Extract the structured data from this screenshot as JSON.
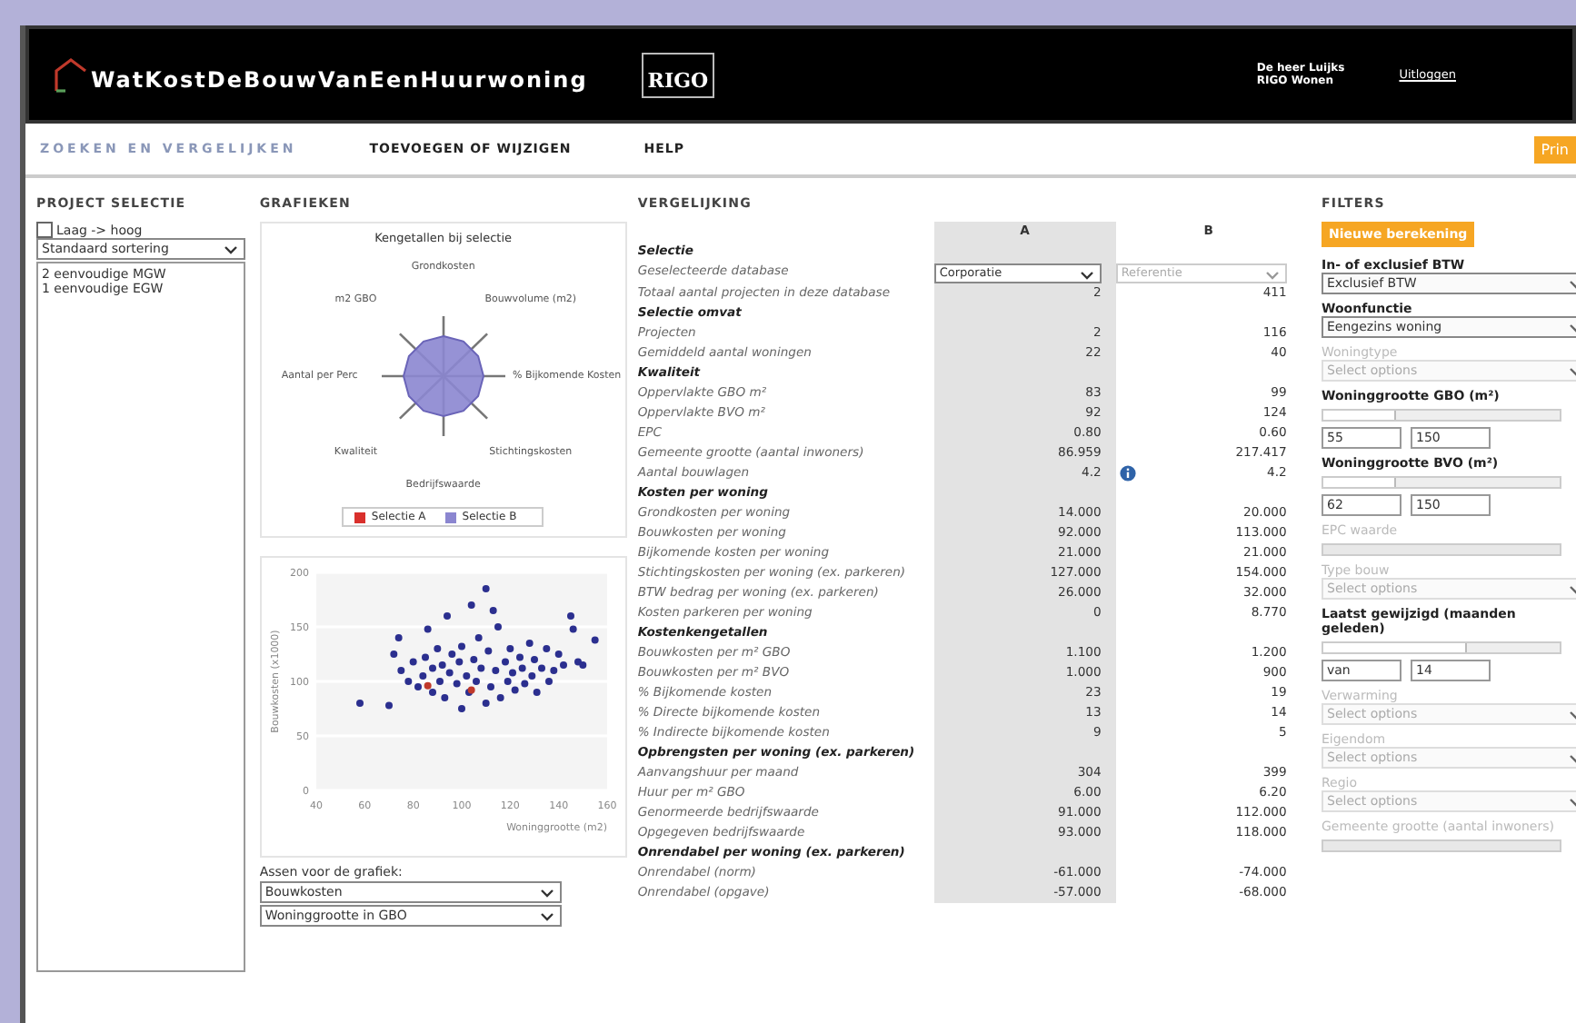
{
  "header": {
    "logo": "WatKostDeBouwVanEenHuurwoning",
    "partner_logo": "RIGO",
    "user": "De heer Luijks",
    "organisation": "RIGO Wonen",
    "logout": "Uitloggen"
  },
  "nav": {
    "tabs": [
      {
        "label": "ZOEKEN EN VERGELIJKEN",
        "selected": true
      },
      {
        "label": "TOEVOEGEN OF WIJZIGEN",
        "selected": false
      },
      {
        "label": "HELP",
        "selected": false
      }
    ],
    "action": "Prin"
  },
  "project_selectie": {
    "title": "PROJECT SELECTIE",
    "sort_checkbox": {
      "label": "Laag -> hoog",
      "checked": false
    },
    "sort_select": "Standaard sortering",
    "items": [
      "2 eenvoudige MGW",
      "1 eenvoudige EGW"
    ]
  },
  "grafieken": {
    "title": "GRAFIEKEN",
    "radar": {
      "title": "Kengetallen bij selectie",
      "axes": [
        "Grondkosten",
        "m2 GBO",
        "Bouwvolume (m2)",
        "Aantal per Perc",
        "% Bijkomende Kosten",
        "Kwaliteit",
        "Stichtingskosten",
        "Bedrijfswaarde"
      ],
      "legend": [
        {
          "label": "Selectie A",
          "color": "#d9302c"
        },
        {
          "label": "Selectie B",
          "color": "#8b86d0"
        }
      ]
    },
    "scatter": {
      "chart_data": {
        "type": "scatter",
        "xlabel": "Woninggrootte (m2)",
        "ylabel": "Bouwkosten (x1000)",
        "xlim": [
          40,
          160
        ],
        "ylim": [
          0,
          200
        ],
        "xticks": [
          40,
          60,
          80,
          100,
          120,
          140,
          160
        ],
        "yticks": [
          0,
          50,
          100,
          150,
          200
        ],
        "grid": true,
        "series": [
          {
            "color": "#2b2f8f",
            "x": [
              58,
              70,
              74,
              72,
              75,
              78,
              80,
              82,
              84,
              85,
              86,
              88,
              88,
              90,
              91,
              92,
              93,
              94,
              95,
              96,
              98,
              99,
              100,
              100,
              102,
              103,
              104,
              105,
              106,
              107,
              108,
              110,
              110,
              111,
              112,
              113,
              114,
              115,
              116,
              118,
              119,
              120,
              121,
              122,
              124,
              125,
              126,
              128,
              129,
              130,
              131,
              133,
              135,
              136,
              138,
              140,
              142,
              145,
              146,
              148,
              150,
              155
            ],
            "values": [
              80,
              78,
              140,
              125,
              110,
              100,
              118,
              95,
              105,
              122,
              148,
              90,
              112,
              130,
              100,
              115,
              85,
              160,
              108,
              125,
              98,
              118,
              75,
              132,
              105,
              90,
              170,
              120,
              100,
              140,
              112,
              80,
              185,
              128,
              95,
              165,
              110,
              150,
              85,
              118,
              100,
              130,
              108,
              92,
              122,
              112,
              98,
              135,
              105,
              120,
              90,
              112,
              130,
              100,
              110,
              125,
              115,
              160,
              148,
              118,
              115,
              138
            ]
          },
          {
            "color": "#c0392b",
            "x": [
              86,
              104
            ],
            "values": [
              96,
              92
            ]
          }
        ]
      }
    },
    "axes_label": "Assen voor de grafiek:",
    "axes_selects": [
      "Bouwkosten",
      "Woninggrootte in GBO"
    ]
  },
  "vergelijking": {
    "title": "VERGELIJKING",
    "columns": [
      "A",
      "B"
    ],
    "rows": [
      {
        "kind": "section",
        "label": "Selectie"
      },
      {
        "kind": "select",
        "label": "Geselecteerde database",
        "a": "Corporatie",
        "b": "Referentie"
      },
      {
        "kind": "value",
        "label": "Totaal aantal projecten in deze database",
        "a": "2",
        "b": "411"
      },
      {
        "kind": "section",
        "label": "Selectie omvat"
      },
      {
        "kind": "value",
        "label": "Projecten",
        "a": "2",
        "b": "116"
      },
      {
        "kind": "value",
        "label": "Gemiddeld aantal woningen",
        "a": "22",
        "b": "40"
      },
      {
        "kind": "section",
        "label": "Kwaliteit"
      },
      {
        "kind": "value",
        "label": "Oppervlakte GBO m²",
        "a": "83",
        "b": "99"
      },
      {
        "kind": "value",
        "label": "Oppervlakte BVO m²",
        "a": "92",
        "b": "124"
      },
      {
        "kind": "value",
        "label": "EPC",
        "a": "0.80",
        "b": "0.60"
      },
      {
        "kind": "value",
        "label": "Gemeente grootte (aantal inwoners)",
        "a": "86.959",
        "b": "217.417"
      },
      {
        "kind": "value",
        "label": "Aantal bouwlagen",
        "a": "4.2",
        "b": "4.2",
        "info": true
      },
      {
        "kind": "section",
        "label": "Kosten per woning"
      },
      {
        "kind": "value",
        "label": "Grondkosten per woning",
        "a": "14.000",
        "b": "20.000"
      },
      {
        "kind": "value",
        "label": "Bouwkosten per woning",
        "a": "92.000",
        "b": "113.000"
      },
      {
        "kind": "value",
        "label": "Bijkomende kosten per woning",
        "a": "21.000",
        "b": "21.000"
      },
      {
        "kind": "value",
        "label": "Stichtingskosten per woning (ex. parkeren)",
        "a": "127.000",
        "b": "154.000"
      },
      {
        "kind": "value",
        "label": "BTW bedrag per woning (ex. parkeren)",
        "a": "26.000",
        "b": "32.000"
      },
      {
        "kind": "value",
        "label": "Kosten parkeren per woning",
        "a": "0",
        "b": "8.770"
      },
      {
        "kind": "section",
        "label": "Kostenkengetallen"
      },
      {
        "kind": "value",
        "label": "Bouwkosten per m² GBO",
        "a": "1.100",
        "b": "1.200"
      },
      {
        "kind": "value",
        "label": "Bouwkosten per m² BVO",
        "a": "1.000",
        "b": "900"
      },
      {
        "kind": "value",
        "label": "% Bijkomende kosten",
        "a": "23",
        "b": "19"
      },
      {
        "kind": "value",
        "label": "% Directe bijkomende kosten",
        "a": "13",
        "b": "14"
      },
      {
        "kind": "value",
        "label": "% Indirecte bijkomende kosten",
        "a": "9",
        "b": "5"
      },
      {
        "kind": "section",
        "label": "Opbrengsten per woning (ex. parkeren)"
      },
      {
        "kind": "value",
        "label": "Aanvangshuur per maand",
        "a": "304",
        "b": "399"
      },
      {
        "kind": "value",
        "label": "Huur per m² GBO",
        "a": "6.00",
        "b": "6.20"
      },
      {
        "kind": "value",
        "label": "Genormeerde bedrijfswaarde",
        "a": "91.000",
        "b": "112.000"
      },
      {
        "kind": "value",
        "label": "Opgegeven bedrijfswaarde",
        "a": "93.000",
        "b": "118.000"
      },
      {
        "kind": "section",
        "label": "Onrendabel per woning (ex. parkeren)"
      },
      {
        "kind": "value",
        "label": "Onrendabel (norm)",
        "a": "-61.000",
        "b": "-74.000"
      },
      {
        "kind": "value",
        "label": "Onrendabel (opgave)",
        "a": "-57.000",
        "b": "-68.000"
      }
    ]
  },
  "filters": {
    "title": "FILTERS",
    "button": "Nieuwe berekening",
    "items": [
      {
        "kind": "select",
        "label": "In- of exclusief BTW",
        "disabled": false,
        "value": "Exclusief BTW"
      },
      {
        "kind": "select",
        "label": "Woonfunctie",
        "disabled": false,
        "value": "Eengezins woning"
      },
      {
        "kind": "select",
        "label": "Woningtype",
        "disabled": true,
        "placeholder": "Select options"
      },
      {
        "kind": "range",
        "label": "Woninggrootte GBO (m²)",
        "disabled": false,
        "level": 0.3,
        "min": "55",
        "max": "150"
      },
      {
        "kind": "range",
        "label": "Woninggrootte BVO (m²)",
        "disabled": false,
        "level": 0.3,
        "min": "62",
        "max": "150"
      },
      {
        "kind": "slider",
        "label": "EPC waarde",
        "disabled": true
      },
      {
        "kind": "select",
        "label": "Type bouw",
        "disabled": true,
        "placeholder": "Select options"
      },
      {
        "kind": "range",
        "label": "Laatst gewijzigd (maanden geleden)",
        "disabled": false,
        "level": 0.6,
        "min": "van",
        "max": "14"
      },
      {
        "kind": "select",
        "label": "Verwarming",
        "disabled": true,
        "placeholder": "Select options"
      },
      {
        "kind": "select",
        "label": "Eigendom",
        "disabled": true,
        "placeholder": "Select options"
      },
      {
        "kind": "select",
        "label": "Regio",
        "disabled": true,
        "placeholder": "Select options"
      },
      {
        "kind": "slider",
        "label": "Gemeente grootte (aantal inwoners)",
        "disabled": true
      }
    ]
  }
}
